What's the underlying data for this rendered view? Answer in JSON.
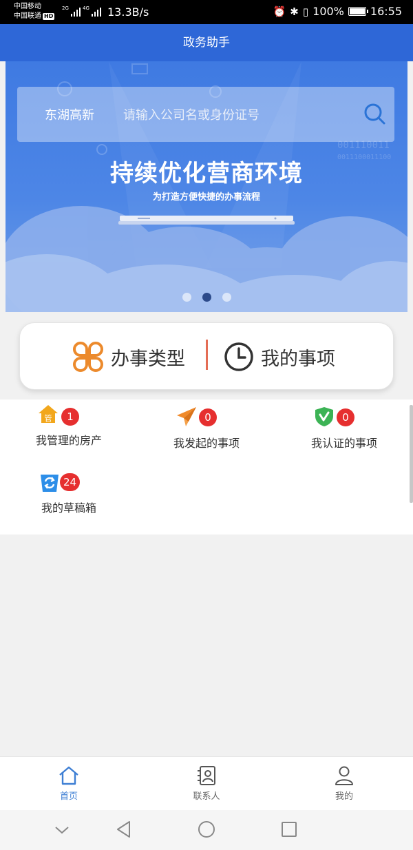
{
  "status_bar": {
    "carrier_1": "中国移动",
    "carrier_2": "中国联通",
    "hd_badge": "HD",
    "network_1": "2G",
    "network_2": "4G",
    "net_speed": "13.3B/s",
    "battery": "100%",
    "time": "16:55"
  },
  "app_bar": {
    "title": "政务助手"
  },
  "banner": {
    "search_region": "东湖高新",
    "search_placeholder": "请输入公司名或身份证号",
    "title": "持续优化营商环境",
    "subtitle": "为打造方便快捷的办事流程",
    "carousel_total": 3,
    "carousel_active": 2
  },
  "actions": {
    "business_type": "办事类型",
    "my_matters": "我的事项"
  },
  "grid": {
    "items": [
      {
        "label": "我管理的房产",
        "badge": "1",
        "icon": "house-manage-icon",
        "icon_text": "管"
      },
      {
        "label": "我发起的事项",
        "badge": "0",
        "icon": "paper-plane-icon"
      },
      {
        "label": "我认证的事项",
        "badge": "0",
        "icon": "verified-shield-icon"
      },
      {
        "label": "我的草稿箱",
        "badge": "24",
        "icon": "draft-box-icon"
      }
    ]
  },
  "bottom_nav": {
    "items": [
      {
        "label": "首页",
        "icon": "home-icon",
        "active": true
      },
      {
        "label": "联系人",
        "icon": "contacts-icon",
        "active": false
      },
      {
        "label": "我的",
        "icon": "profile-icon",
        "active": false
      }
    ]
  },
  "colors": {
    "app_bar": "#2e67d7",
    "badge": "#e62f2f",
    "nav_active": "#3e7fd4",
    "divider": "#e46d55"
  }
}
